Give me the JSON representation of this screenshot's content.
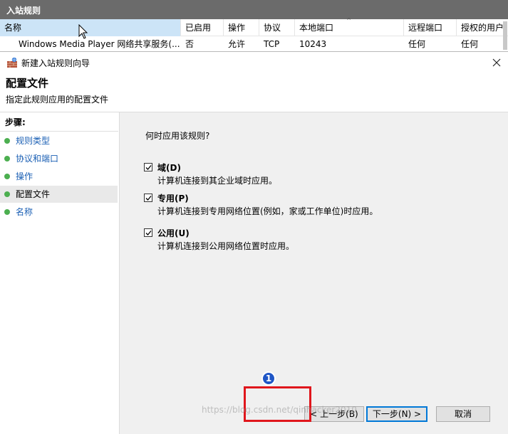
{
  "background": {
    "title": "入站规则",
    "columns": [
      "名称",
      "已启用",
      "操作",
      "协议",
      "本地端口",
      "远程端口",
      "授权的用户"
    ],
    "row": {
      "name": "Windows Media Player 网络共享服务(...",
      "enabled": "否",
      "action": "允许",
      "protocol": "TCP",
      "local_port": "10243",
      "remote_port": "任何",
      "authorized_users": "任何"
    }
  },
  "dialog": {
    "title": "新建入站规则向导",
    "heading": "配置文件",
    "subheading": "指定此规则应用的配置文件",
    "steps_title": "步骤:",
    "steps": [
      {
        "label": "规则类型",
        "active": false
      },
      {
        "label": "协议和端口",
        "active": false
      },
      {
        "label": "操作",
        "active": false
      },
      {
        "label": "配置文件",
        "active": true
      },
      {
        "label": "名称",
        "active": false
      }
    ],
    "question": "何时应用该规则?",
    "options": [
      {
        "label": "域(D)",
        "desc": "计算机连接到其企业域时应用。",
        "checked": true
      },
      {
        "label": "专用(P)",
        "desc": "计算机连接到专用网络位置(例如，家或工作单位)时应用。",
        "checked": true
      },
      {
        "label": "公用(U)",
        "desc": "计算机连接到公用网络位置时应用。",
        "checked": true
      }
    ],
    "buttons": {
      "back": "< 上一步(B)",
      "next": "下一步(N) >",
      "cancel": "取消"
    }
  },
  "annotation": {
    "badge": "1",
    "color": "#e0161c"
  },
  "watermark": "https://blog.csdn.net/qinhacker2010"
}
